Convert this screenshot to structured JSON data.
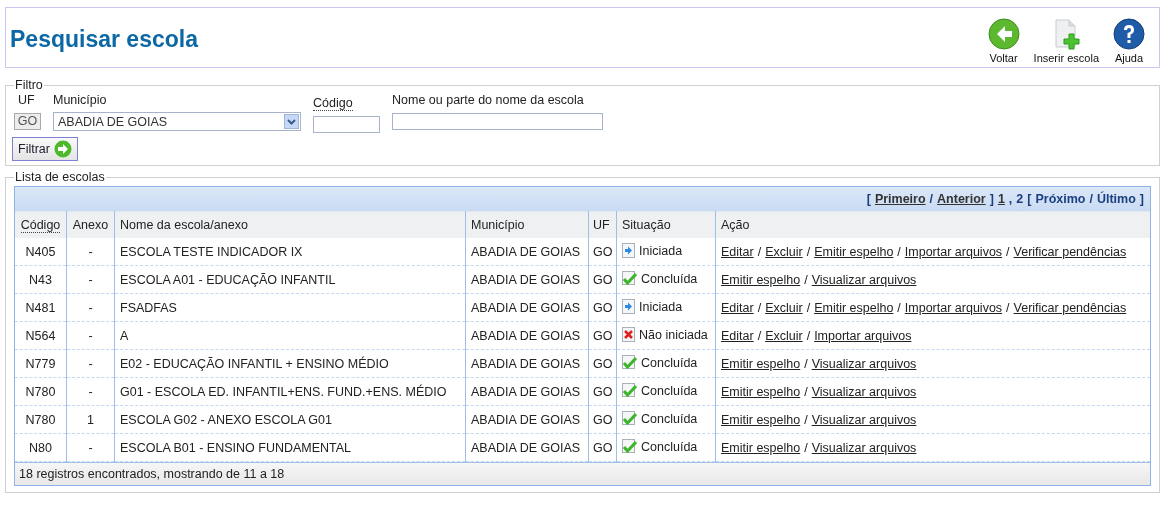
{
  "page": {
    "title": "Pesquisar escola"
  },
  "toolbar": [
    {
      "label": "Voltar",
      "kind": "back"
    },
    {
      "label": "Inserir escola",
      "kind": "insert"
    },
    {
      "label": "Ajuda",
      "kind": "help"
    }
  ],
  "filter": {
    "legend": "Filtro",
    "uf_label": "UF",
    "uf_value": "GO",
    "municipio_label": "Município",
    "municipio_value": "ABADIA DE GOIAS",
    "codigo_label": "Código",
    "nome_label": "Nome ou parte do nome da escola",
    "button": "Filtrar"
  },
  "list": {
    "legend": "Lista de escolas",
    "pager": [
      {
        "text": "[",
        "kind": "plain"
      },
      {
        "text": "Primeiro",
        "kind": "link"
      },
      {
        "text": "/",
        "kind": "plain"
      },
      {
        "text": "Anterior",
        "kind": "link"
      },
      {
        "text": "]",
        "kind": "plain"
      },
      {
        "text": "1",
        "kind": "link"
      },
      {
        "text": ",",
        "kind": "plain"
      },
      {
        "text": "2",
        "kind": "plain"
      },
      {
        "text": "[",
        "kind": "plain"
      },
      {
        "text": "Próximo",
        "kind": "plain"
      },
      {
        "text": "/",
        "kind": "plain"
      },
      {
        "text": "Último",
        "kind": "plain"
      },
      {
        "text": "]",
        "kind": "plain"
      }
    ],
    "columns": [
      "Código",
      "Anexo",
      "Nome da escola/anexo",
      "Município",
      "UF",
      "Situação",
      "Ação"
    ],
    "rows": [
      {
        "codigo": "N405",
        "anexo": "-",
        "nome": "ESCOLA TESTE INDICADOR IX",
        "municipio": "ABADIA DE GOIAS",
        "uf": "GO",
        "status": "Iniciada",
        "kind": "started",
        "actions": [
          "Editar",
          "/",
          "Excluir",
          "/",
          "Emitir espelho",
          "/",
          "Importar arquivos",
          "/",
          "Verificar pendências"
        ]
      },
      {
        "codigo": "N43",
        "anexo": "-",
        "nome": "ESCOLA A01 - EDUCAÇÃO INFANTIL",
        "municipio": "ABADIA DE GOIAS",
        "uf": "GO",
        "status": "Concluída",
        "kind": "done",
        "actions": [
          "Emitir espelho",
          "/",
          "Visualizar arquivos"
        ]
      },
      {
        "codigo": "N481",
        "anexo": "-",
        "nome": "FSADFAS",
        "municipio": "ABADIA DE GOIAS",
        "uf": "GO",
        "status": "Iniciada",
        "kind": "started",
        "actions": [
          "Editar",
          "/",
          "Excluir",
          "/",
          "Emitir espelho",
          "/",
          "Importar arquivos",
          "/",
          "Verificar pendências"
        ]
      },
      {
        "codigo": "N564",
        "anexo": "-",
        "nome": "A",
        "municipio": "ABADIA DE GOIAS",
        "uf": "GO",
        "status": "Não iniciada",
        "kind": "not_started",
        "actions": [
          "Editar",
          "/",
          "Excluir",
          "/",
          "Importar arquivos"
        ]
      },
      {
        "codigo": "N779",
        "anexo": "-",
        "nome": "E02 - EDUCAÇÃO INFANTIL + ENSINO MÉDIO",
        "municipio": "ABADIA DE GOIAS",
        "uf": "GO",
        "status": "Concluída",
        "kind": "done",
        "actions": [
          "Emitir espelho",
          "/",
          "Visualizar arquivos"
        ]
      },
      {
        "codigo": "N780",
        "anexo": "-",
        "nome": "G01 - ESCOLA ED. INFANTIL+ENS. FUND.+ENS. MÉDIO",
        "municipio": "ABADIA DE GOIAS",
        "uf": "GO",
        "status": "Concluída",
        "kind": "done",
        "actions": [
          "Emitir espelho",
          "/",
          "Visualizar arquivos"
        ]
      },
      {
        "codigo": "N780",
        "anexo": "1",
        "nome": "ESCOLA G02 - ANEXO ESCOLA G01",
        "municipio": "ABADIA DE GOIAS",
        "uf": "GO",
        "status": "Concluída",
        "kind": "done",
        "actions": [
          "Emitir espelho",
          "/",
          "Visualizar arquivos"
        ]
      },
      {
        "codigo": "N80",
        "anexo": "-",
        "nome": "ESCOLA B01 - ENSINO FUNDAMENTAL",
        "municipio": "ABADIA DE GOIAS",
        "uf": "GO",
        "status": "Concluída",
        "kind": "done",
        "actions": [
          "Emitir espelho",
          "/",
          "Visualizar arquivos"
        ]
      }
    ],
    "footer": "18 registros encontrados, mostrando de 11 a 18"
  }
}
